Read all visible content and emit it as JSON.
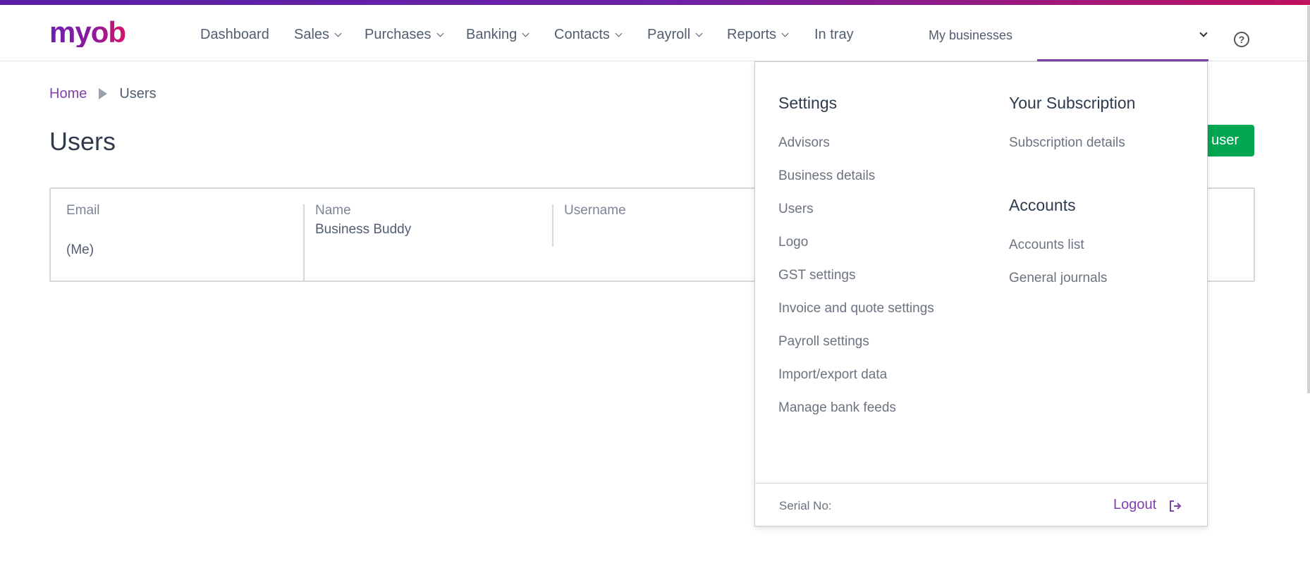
{
  "brand": {
    "logo_text": "myob",
    "accent_color": "#8241aa",
    "primary_button_color": "#00a651"
  },
  "nav": {
    "items": [
      {
        "label": "Dashboard",
        "has_dropdown": false
      },
      {
        "label": "Sales",
        "has_dropdown": true
      },
      {
        "label": "Purchases",
        "has_dropdown": true
      },
      {
        "label": "Banking",
        "has_dropdown": true
      },
      {
        "label": "Contacts",
        "has_dropdown": true
      },
      {
        "label": "Payroll",
        "has_dropdown": true
      },
      {
        "label": "Reports",
        "has_dropdown": true
      },
      {
        "label": "In tray",
        "has_dropdown": false
      }
    ],
    "business_switcher_label": "My businesses",
    "help_icon": "help-circle-icon"
  },
  "breadcrumb": {
    "home": "Home",
    "current": "Users"
  },
  "page": {
    "title": "Users",
    "create_button_label": "user"
  },
  "user_card": {
    "email_label": "Email",
    "email_suffix": "(Me)",
    "name_label": "Name",
    "name_value": "Business Buddy",
    "username_label": "Username"
  },
  "dropdown": {
    "settings_heading": "Settings",
    "settings_items": [
      "Advisors",
      "Business details",
      "Users",
      "Logo",
      "GST settings",
      "Invoice and quote settings",
      "Payroll settings",
      "Import/export data",
      "Manage bank feeds"
    ],
    "subscription_heading": "Your Subscription",
    "subscription_items": [
      "Subscription details"
    ],
    "accounts_heading": "Accounts",
    "accounts_items": [
      "Accounts list",
      "General journals"
    ],
    "serial_label": "Serial No:",
    "logout_label": "Logout"
  }
}
